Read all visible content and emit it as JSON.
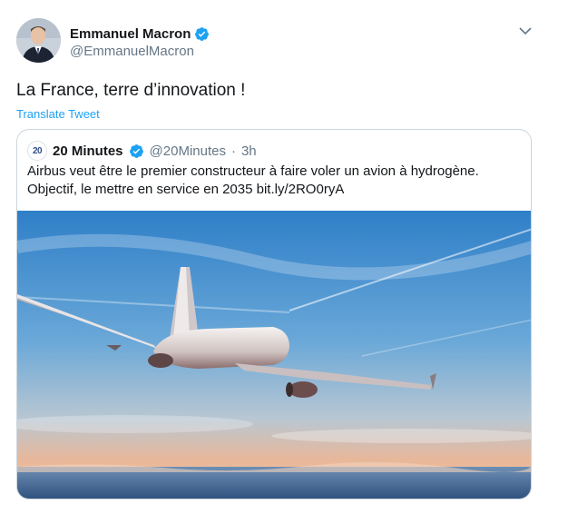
{
  "author": {
    "display_name": "Emmanuel Macron",
    "handle": "@EmmanuelMacron",
    "avatar_icon": "avatar-photo",
    "verified_icon": "verified-badge-icon"
  },
  "tweet": {
    "text": "La France, terre d’innovation !",
    "translate_label": "Translate Tweet",
    "menu_icon": "chevron-down-icon"
  },
  "quoted_tweet": {
    "display_name": "20 Minutes",
    "handle": "@20Minutes",
    "separator": "·",
    "time": "3h",
    "logo_text": "20",
    "text_line1": "Airbus veut être le premier constructeur à faire voler un avion à hydrogène.",
    "text_line2": "Objectif, le mettre en service en 2035 bit.ly/2RO0ryA",
    "media_icon": "airplane-photo"
  },
  "colors": {
    "link": "#1da1f2",
    "secondary_text": "#657786",
    "border": "#ccd6dd"
  }
}
